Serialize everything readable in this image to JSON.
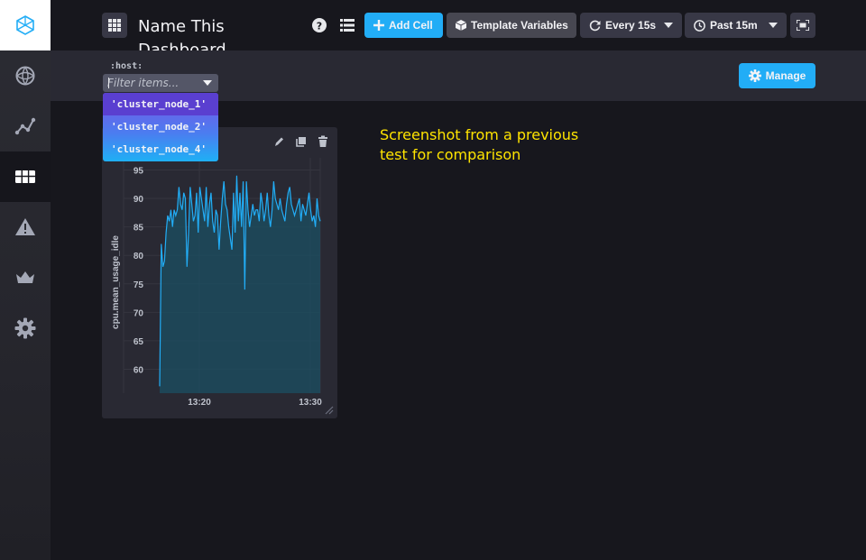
{
  "app": {
    "dashboard_title": "Name This Dashboard"
  },
  "sidebar": {
    "items": [
      {
        "name": "logo-icon"
      },
      {
        "name": "data-explorer-icon"
      },
      {
        "name": "graph-icon"
      },
      {
        "name": "dashboards-icon",
        "active": true
      },
      {
        "name": "alerts-icon"
      },
      {
        "name": "admin-icon"
      },
      {
        "name": "settings-icon"
      }
    ]
  },
  "header": {
    "add_cell_label": "Add Cell",
    "template_variables_label": "Template Variables",
    "refresh_label": "Every 15s",
    "range_label": "Past 15m"
  },
  "template_bar": {
    "variable_name": ":host:",
    "filter_placeholder": "Filter items...",
    "manage_label": "Manage",
    "options": [
      "'cluster_node_1'",
      "'cluster_node_2'",
      "'cluster_node_4'"
    ],
    "selected_index": 0
  },
  "cell": {
    "chart_data": {
      "type": "area",
      "ylabel": "cpu.mean_usage_idle",
      "y_ticks": [
        60,
        65,
        70,
        75,
        80,
        85,
        90,
        95
      ],
      "x_tick_labels": [
        "13:20",
        "13:30"
      ],
      "ylim": [
        55.8,
        96.5
      ],
      "x": [
        0,
        1,
        2,
        3,
        4,
        5,
        6,
        7,
        8,
        9,
        10,
        11,
        12,
        13,
        14,
        15,
        16,
        17,
        18,
        19,
        20,
        21,
        22,
        23,
        24,
        25,
        26,
        27,
        28,
        29,
        30,
        31,
        32,
        33,
        34,
        35,
        36,
        37,
        38,
        39,
        40,
        41,
        42,
        43,
        44,
        45,
        46,
        47,
        48,
        49,
        50,
        51,
        52,
        53,
        54,
        55,
        56,
        57,
        58,
        59,
        60,
        61,
        62,
        63,
        64,
        65,
        66,
        67,
        68,
        69,
        70,
        71,
        72,
        73,
        74,
        75,
        76,
        77,
        78,
        79,
        80,
        81,
        82,
        83,
        84,
        85,
        86,
        87,
        88,
        89,
        90,
        91,
        92,
        93,
        94,
        95,
        96,
        97,
        98,
        99,
        100
      ],
      "values": [
        57,
        82,
        78,
        79,
        84,
        87,
        86,
        88,
        85,
        88,
        87,
        88,
        92,
        89,
        88,
        91,
        90,
        78,
        84,
        92,
        89,
        86,
        87,
        91,
        84,
        92,
        90,
        88,
        86,
        92,
        85,
        89,
        91,
        86,
        84,
        88,
        87,
        81,
        86,
        90,
        93,
        89,
        88,
        85,
        83,
        81,
        91,
        84,
        94,
        86,
        91,
        85,
        93,
        74,
        93,
        88,
        85,
        87,
        89,
        87,
        88,
        88,
        86,
        91,
        89,
        86,
        88,
        91,
        87,
        85,
        88,
        93,
        90,
        89,
        88,
        90,
        88,
        87,
        86,
        89,
        91,
        92,
        89,
        88,
        87,
        88,
        89,
        90,
        86,
        89,
        88,
        87,
        89,
        91,
        88,
        86,
        87,
        85,
        90,
        87,
        86
      ],
      "x_range": [
        0,
        100
      ],
      "grid": true,
      "line_color": "#22adf6",
      "fill_color": "#1b4f63"
    }
  },
  "annotation": {
    "line1": "Screenshot from a previous",
    "line2": "test for comparison"
  }
}
